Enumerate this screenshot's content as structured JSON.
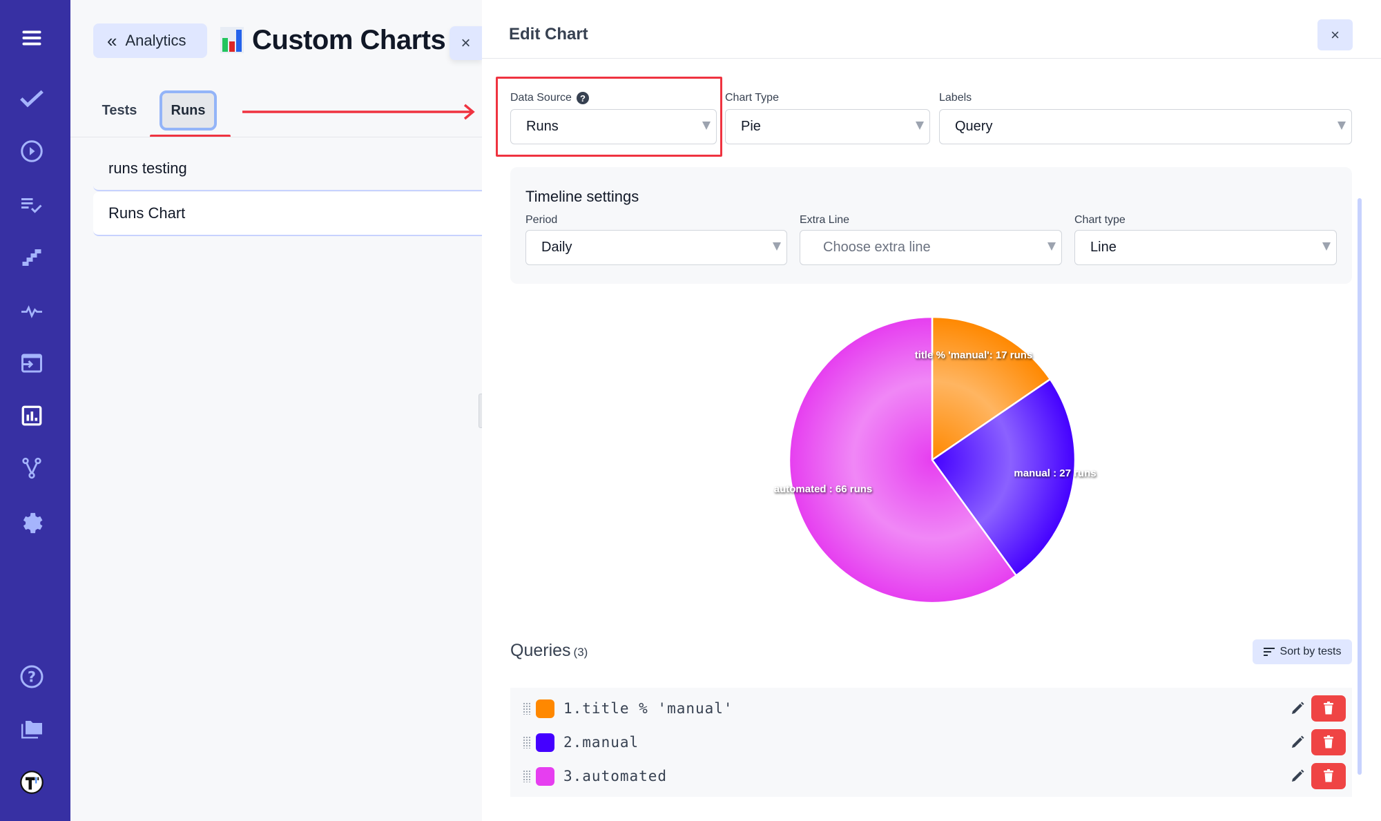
{
  "sidebar": {
    "items": [
      {
        "name": "menu",
        "icon": "hamburger-icon"
      },
      {
        "name": "tests",
        "icon": "check-icon"
      },
      {
        "name": "runs",
        "icon": "play-circle-icon"
      },
      {
        "name": "plans",
        "icon": "checklist-icon"
      },
      {
        "name": "steps",
        "icon": "stairs-icon"
      },
      {
        "name": "pulse",
        "icon": "pulse-icon"
      },
      {
        "name": "imports",
        "icon": "import-icon"
      },
      {
        "name": "analytics",
        "icon": "bar-chart-icon",
        "active": true
      },
      {
        "name": "branches",
        "icon": "branch-icon"
      },
      {
        "name": "settings",
        "icon": "gear-icon"
      },
      {
        "name": "help",
        "icon": "help-circle-icon"
      },
      {
        "name": "projects",
        "icon": "folders-icon"
      },
      {
        "name": "logo",
        "icon": "testomat-logo-icon"
      }
    ]
  },
  "left": {
    "back_button": "Analytics",
    "title": "Custom Charts",
    "close_label": "×",
    "tabs": [
      {
        "label": "Tests",
        "active": false
      },
      {
        "label": "Runs",
        "active": true
      }
    ],
    "charts": [
      {
        "label": "runs testing"
      },
      {
        "label": "Runs Chart",
        "selected": true
      }
    ]
  },
  "editor": {
    "title": "Edit Chart",
    "close_label": "×",
    "data_source": {
      "label": "Data Source",
      "help": "?",
      "value": "Runs"
    },
    "chart_type": {
      "label": "Chart Type",
      "value": "Pie"
    },
    "labels": {
      "label": "Labels",
      "value": "Query"
    },
    "timeline": {
      "title": "Timeline settings",
      "period": {
        "label": "Period",
        "value": "Daily"
      },
      "extra_line": {
        "label": "Extra Line",
        "placeholder": "Choose extra line"
      },
      "chart_type": {
        "label": "Chart type",
        "value": "Line"
      }
    },
    "queries": {
      "title": "Queries",
      "count": "(3)",
      "sort_label": "Sort by tests",
      "items": [
        {
          "text": "1.title % 'manual'",
          "color": "#ff8800"
        },
        {
          "text": "2.manual",
          "color": "#4400ff"
        },
        {
          "text": "3.automated",
          "color": "#e63ef0"
        }
      ]
    }
  },
  "colors": {
    "sidebar_bg": "#3730a3",
    "accent_light": "#e0e7ff",
    "highlight_red": "#ef3340",
    "delete_red": "#ef4444"
  },
  "chart_data": {
    "type": "pie",
    "title": "",
    "categories": [
      "title % 'manual'",
      "manual",
      "automated"
    ],
    "values": [
      17,
      27,
      66
    ],
    "unit": "runs",
    "colors": [
      "#ff8800",
      "#4400ff",
      "#e63ef0"
    ],
    "labels": [
      "title % 'manual': 17 runs",
      "manual : 27 runs",
      "automated : 66 runs"
    ],
    "start_angle": "top",
    "direction": "clockwise",
    "legend": "none"
  }
}
